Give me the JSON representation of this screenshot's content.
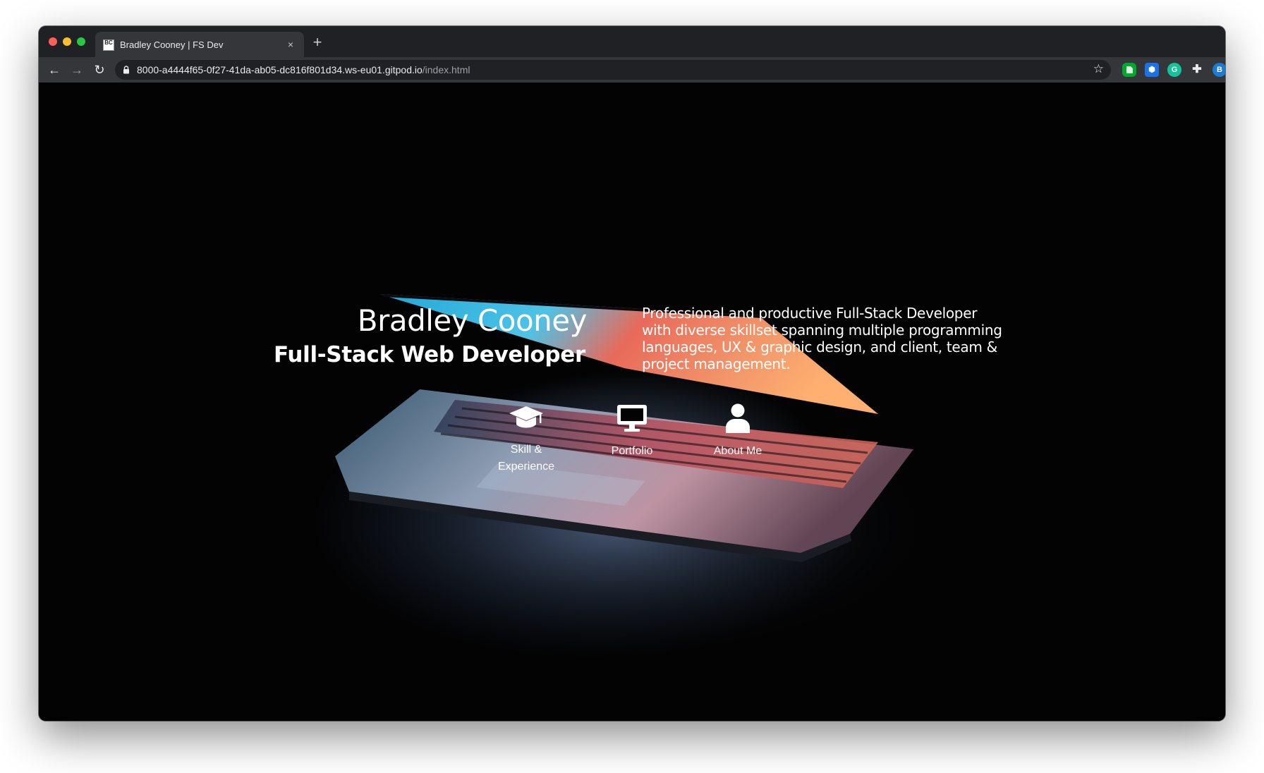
{
  "browser": {
    "tab_title": "Bradley Cooney | FS Dev",
    "tab_favicon_text": "BC",
    "close_glyph": "×",
    "new_tab_glyph": "+",
    "back_glyph": "←",
    "forward_glyph": "→",
    "reload_glyph": "↻",
    "url_host": "8000-a4444f65-0f27-41da-ab05-dc816f801d34.ws-eu01.gitpod.io",
    "url_path": "/index.html",
    "star_glyph": "☆",
    "extensions": {
      "cube": "⬢",
      "grammarly": "G",
      "puzzle": "✚",
      "profile": "B",
      "update": "⬆"
    }
  },
  "hero": {
    "name": "Bradley Cooney",
    "role": "Full-Stack Web Developer",
    "description": "Professional and productive Full-Stack Developer with diverse skillset spanning multiple programming languages, UX & graphic design, and client, team & project management."
  },
  "nav": {
    "skill_label": "Skill & Experience",
    "portfolio_label": "Portfolio",
    "about_label": "About Me",
    "skill_icon": "graduation-cap-icon",
    "portfolio_icon": "desktop-icon",
    "about_icon": "user-icon"
  },
  "colors": {
    "chrome_dark": "#202124",
    "chrome_toolbar": "#35363a",
    "page_bg": "#030304",
    "text": "#ffffff"
  }
}
